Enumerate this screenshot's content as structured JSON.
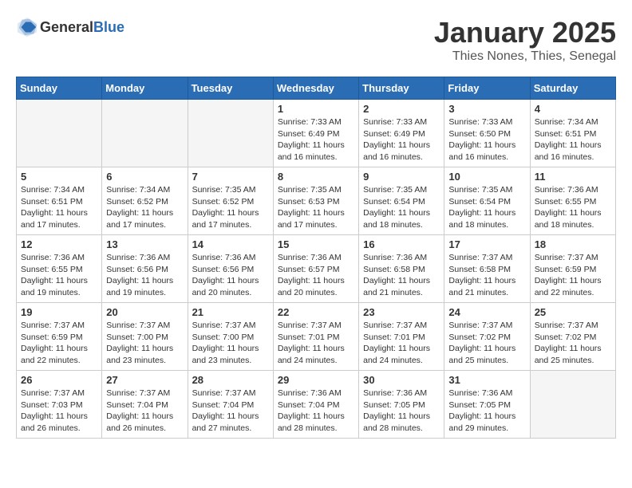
{
  "header": {
    "logo_general": "General",
    "logo_blue": "Blue",
    "month": "January 2025",
    "location": "Thies Nones, Thies, Senegal"
  },
  "weekdays": [
    "Sunday",
    "Monday",
    "Tuesday",
    "Wednesday",
    "Thursday",
    "Friday",
    "Saturday"
  ],
  "weeks": [
    [
      {
        "day": "",
        "empty": true
      },
      {
        "day": "",
        "empty": true
      },
      {
        "day": "",
        "empty": true
      },
      {
        "day": "1",
        "sunrise": "Sunrise: 7:33 AM",
        "sunset": "Sunset: 6:49 PM",
        "daylight": "Daylight: 11 hours and 16 minutes."
      },
      {
        "day": "2",
        "sunrise": "Sunrise: 7:33 AM",
        "sunset": "Sunset: 6:49 PM",
        "daylight": "Daylight: 11 hours and 16 minutes."
      },
      {
        "day": "3",
        "sunrise": "Sunrise: 7:33 AM",
        "sunset": "Sunset: 6:50 PM",
        "daylight": "Daylight: 11 hours and 16 minutes."
      },
      {
        "day": "4",
        "sunrise": "Sunrise: 7:34 AM",
        "sunset": "Sunset: 6:51 PM",
        "daylight": "Daylight: 11 hours and 16 minutes."
      }
    ],
    [
      {
        "day": "5",
        "sunrise": "Sunrise: 7:34 AM",
        "sunset": "Sunset: 6:51 PM",
        "daylight": "Daylight: 11 hours and 17 minutes."
      },
      {
        "day": "6",
        "sunrise": "Sunrise: 7:34 AM",
        "sunset": "Sunset: 6:52 PM",
        "daylight": "Daylight: 11 hours and 17 minutes."
      },
      {
        "day": "7",
        "sunrise": "Sunrise: 7:35 AM",
        "sunset": "Sunset: 6:52 PM",
        "daylight": "Daylight: 11 hours and 17 minutes."
      },
      {
        "day": "8",
        "sunrise": "Sunrise: 7:35 AM",
        "sunset": "Sunset: 6:53 PM",
        "daylight": "Daylight: 11 hours and 17 minutes."
      },
      {
        "day": "9",
        "sunrise": "Sunrise: 7:35 AM",
        "sunset": "Sunset: 6:54 PM",
        "daylight": "Daylight: 11 hours and 18 minutes."
      },
      {
        "day": "10",
        "sunrise": "Sunrise: 7:35 AM",
        "sunset": "Sunset: 6:54 PM",
        "daylight": "Daylight: 11 hours and 18 minutes."
      },
      {
        "day": "11",
        "sunrise": "Sunrise: 7:36 AM",
        "sunset": "Sunset: 6:55 PM",
        "daylight": "Daylight: 11 hours and 18 minutes."
      }
    ],
    [
      {
        "day": "12",
        "sunrise": "Sunrise: 7:36 AM",
        "sunset": "Sunset: 6:55 PM",
        "daylight": "Daylight: 11 hours and 19 minutes."
      },
      {
        "day": "13",
        "sunrise": "Sunrise: 7:36 AM",
        "sunset": "Sunset: 6:56 PM",
        "daylight": "Daylight: 11 hours and 19 minutes."
      },
      {
        "day": "14",
        "sunrise": "Sunrise: 7:36 AM",
        "sunset": "Sunset: 6:56 PM",
        "daylight": "Daylight: 11 hours and 20 minutes."
      },
      {
        "day": "15",
        "sunrise": "Sunrise: 7:36 AM",
        "sunset": "Sunset: 6:57 PM",
        "daylight": "Daylight: 11 hours and 20 minutes."
      },
      {
        "day": "16",
        "sunrise": "Sunrise: 7:36 AM",
        "sunset": "Sunset: 6:58 PM",
        "daylight": "Daylight: 11 hours and 21 minutes."
      },
      {
        "day": "17",
        "sunrise": "Sunrise: 7:37 AM",
        "sunset": "Sunset: 6:58 PM",
        "daylight": "Daylight: 11 hours and 21 minutes."
      },
      {
        "day": "18",
        "sunrise": "Sunrise: 7:37 AM",
        "sunset": "Sunset: 6:59 PM",
        "daylight": "Daylight: 11 hours and 22 minutes."
      }
    ],
    [
      {
        "day": "19",
        "sunrise": "Sunrise: 7:37 AM",
        "sunset": "Sunset: 6:59 PM",
        "daylight": "Daylight: 11 hours and 22 minutes."
      },
      {
        "day": "20",
        "sunrise": "Sunrise: 7:37 AM",
        "sunset": "Sunset: 7:00 PM",
        "daylight": "Daylight: 11 hours and 23 minutes."
      },
      {
        "day": "21",
        "sunrise": "Sunrise: 7:37 AM",
        "sunset": "Sunset: 7:00 PM",
        "daylight": "Daylight: 11 hours and 23 minutes."
      },
      {
        "day": "22",
        "sunrise": "Sunrise: 7:37 AM",
        "sunset": "Sunset: 7:01 PM",
        "daylight": "Daylight: 11 hours and 24 minutes."
      },
      {
        "day": "23",
        "sunrise": "Sunrise: 7:37 AM",
        "sunset": "Sunset: 7:01 PM",
        "daylight": "Daylight: 11 hours and 24 minutes."
      },
      {
        "day": "24",
        "sunrise": "Sunrise: 7:37 AM",
        "sunset": "Sunset: 7:02 PM",
        "daylight": "Daylight: 11 hours and 25 minutes."
      },
      {
        "day": "25",
        "sunrise": "Sunrise: 7:37 AM",
        "sunset": "Sunset: 7:02 PM",
        "daylight": "Daylight: 11 hours and 25 minutes."
      }
    ],
    [
      {
        "day": "26",
        "sunrise": "Sunrise: 7:37 AM",
        "sunset": "Sunset: 7:03 PM",
        "daylight": "Daylight: 11 hours and 26 minutes."
      },
      {
        "day": "27",
        "sunrise": "Sunrise: 7:37 AM",
        "sunset": "Sunset: 7:04 PM",
        "daylight": "Daylight: 11 hours and 26 minutes."
      },
      {
        "day": "28",
        "sunrise": "Sunrise: 7:37 AM",
        "sunset": "Sunset: 7:04 PM",
        "daylight": "Daylight: 11 hours and 27 minutes."
      },
      {
        "day": "29",
        "sunrise": "Sunrise: 7:36 AM",
        "sunset": "Sunset: 7:04 PM",
        "daylight": "Daylight: 11 hours and 28 minutes."
      },
      {
        "day": "30",
        "sunrise": "Sunrise: 7:36 AM",
        "sunset": "Sunset: 7:05 PM",
        "daylight": "Daylight: 11 hours and 28 minutes."
      },
      {
        "day": "31",
        "sunrise": "Sunrise: 7:36 AM",
        "sunset": "Sunset: 7:05 PM",
        "daylight": "Daylight: 11 hours and 29 minutes."
      },
      {
        "day": "",
        "empty": true
      }
    ]
  ]
}
